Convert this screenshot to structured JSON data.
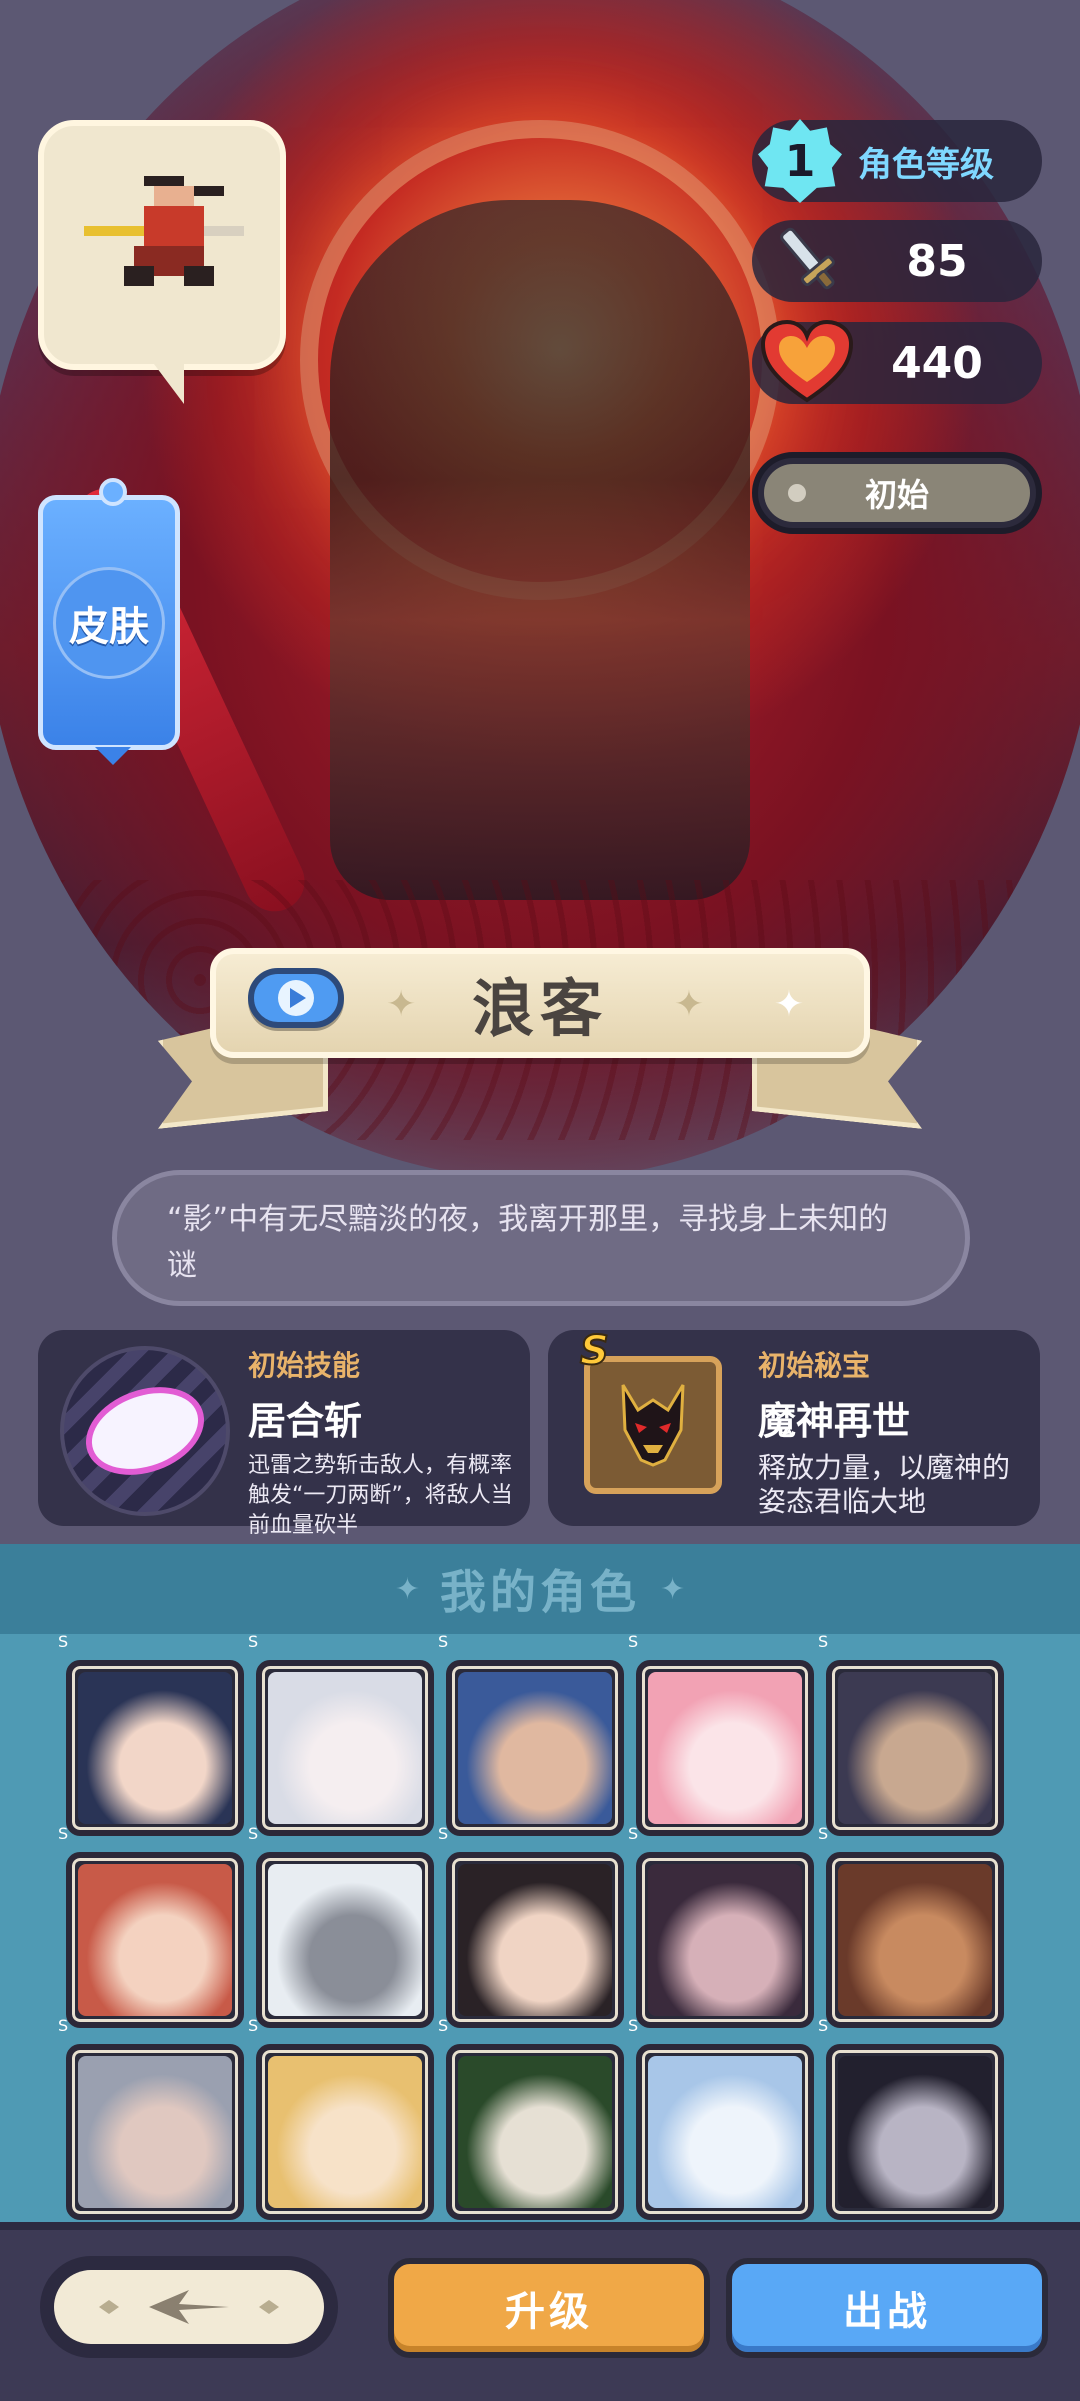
{
  "hero": {
    "name": "浪客",
    "quote": "“影”中有无尽黯淡的夜，我离开那里，寻找身上未知的谜"
  },
  "skin_button": {
    "label": "皮肤"
  },
  "stats": {
    "level_value": "1",
    "level_label": "角色等级",
    "attack_value": "85",
    "hp_value": "440",
    "status_label": "初始"
  },
  "skills": [
    {
      "type": "初始技能",
      "name": "居合斩",
      "desc": "迅雷之势斩击敌人，有概率触发“一刀两断”，将敌人当前血量砍半"
    },
    {
      "type": "初始秘宝",
      "grade": "S",
      "name": "魔神再世",
      "desc": "释放力量，以魔神的姿态君临大地"
    }
  ],
  "roles": {
    "title": "我的角色",
    "grade": "S",
    "cards": [
      {
        "color_a": "#2a3456",
        "color_b": "#f2d6c8"
      },
      {
        "color_a": "#d9dce6",
        "color_b": "#f5eef0"
      },
      {
        "color_a": "#3a5a9a",
        "color_b": "#e0b8a0"
      },
      {
        "color_a": "#f2a2b4",
        "color_b": "#fbe4e8"
      },
      {
        "color_a": "#3c3a52",
        "color_b": "#c8a890"
      },
      {
        "color_a": "#c85a48",
        "color_b": "#f4d2c0"
      },
      {
        "color_a": "#e8edf2",
        "color_b": "#8a8e98"
      },
      {
        "color_a": "#2a2226",
        "color_b": "#f0d4c4"
      },
      {
        "color_a": "#3a2a3c",
        "color_b": "#d6b0b8"
      },
      {
        "color_a": "#6a3a2a",
        "color_b": "#c88a60"
      },
      {
        "color_a": "#9aa0b0",
        "color_b": "#e0c8c0"
      },
      {
        "color_a": "#e8c070",
        "color_b": "#f7e2c8"
      },
      {
        "color_a": "#2a4a2a",
        "color_b": "#e6e0d4"
      },
      {
        "color_a": "#a8c6e8",
        "color_b": "#eef4fb"
      },
      {
        "color_a": "#22202e",
        "color_b": "#b8b4c4"
      }
    ]
  },
  "actions": {
    "upgrade": "升级",
    "battle": "出战"
  },
  "colors": {
    "accent_blue": "#59a8f6",
    "accent_orange": "#f0a847",
    "gold": "#ffc93a"
  }
}
